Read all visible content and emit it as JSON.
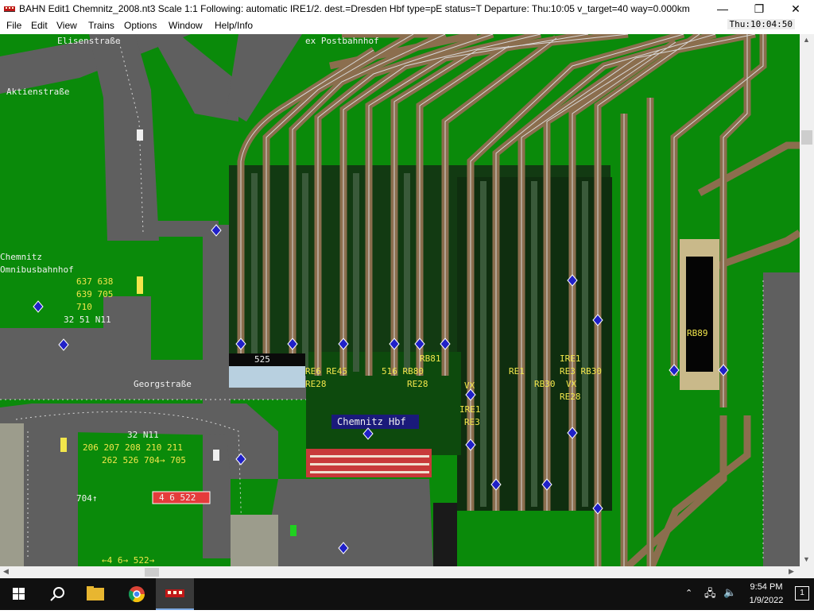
{
  "window": {
    "title": "BAHN Edit1 Chemnitz_2008.nt3 Scale 1:1 Following: automatic IRE1/2.  dest.=Dresden Hbf type=pE status=T  Departure: Thu:10:05 v_target=40 way=0.000km",
    "buttons": {
      "minimize": "—",
      "maximize": "❐",
      "close": "✕"
    }
  },
  "menu": [
    "File",
    "Edit",
    "View",
    "Trains",
    "Options",
    "Window",
    "Help/Info"
  ],
  "clock": "Thu:10:04:50",
  "map": {
    "streets": [
      "Elisenstraße",
      "ex Postbahnhof",
      "Aktienstraße",
      "Georgstraße"
    ],
    "bus_station": {
      "name_line1": "Chemnitz",
      "name_line2": "Omnibusbahnhof",
      "routes": [
        "637 638",
        "639 705",
        "710",
        "32 51 N11"
      ]
    },
    "lower_left_routes": [
      "32 N11",
      "206 207 208 210 211",
      "262 526 704→ 705",
      "704↑",
      "←4 6→ 522→"
    ],
    "tram_sign": "4 6 522",
    "station": "Chemnitz Hbf",
    "station_building_number": "525",
    "platform_labels": [
      "RE6 RE45",
      "RE28",
      "516 RB80",
      "RE28",
      "RB81",
      "VX",
      "IRE1",
      "RE3",
      "RE1",
      "RB30",
      "IRE1",
      "RE3 RB30",
      "VX",
      "RE28",
      "RB89"
    ],
    "colors": {
      "grass": "#0a8a0a",
      "road": "#5f5f5f",
      "track_ballast": "#8b6e4e",
      "rail": "#d8d8d8",
      "platform_roof": "#123a12",
      "signal_blue": "#2020c8",
      "label_yellow": "#f2e64b",
      "station_sign_bg": "#1a1a7a",
      "tram_sign_bg": "#e53b3b"
    }
  },
  "taskbar": {
    "time": "9:54 PM",
    "date": "1/9/2022",
    "notification_count": "1",
    "icons": [
      "windows-start-icon",
      "search-icon",
      "file-explorer-icon",
      "chrome-icon",
      "bahn-app-icon"
    ]
  }
}
